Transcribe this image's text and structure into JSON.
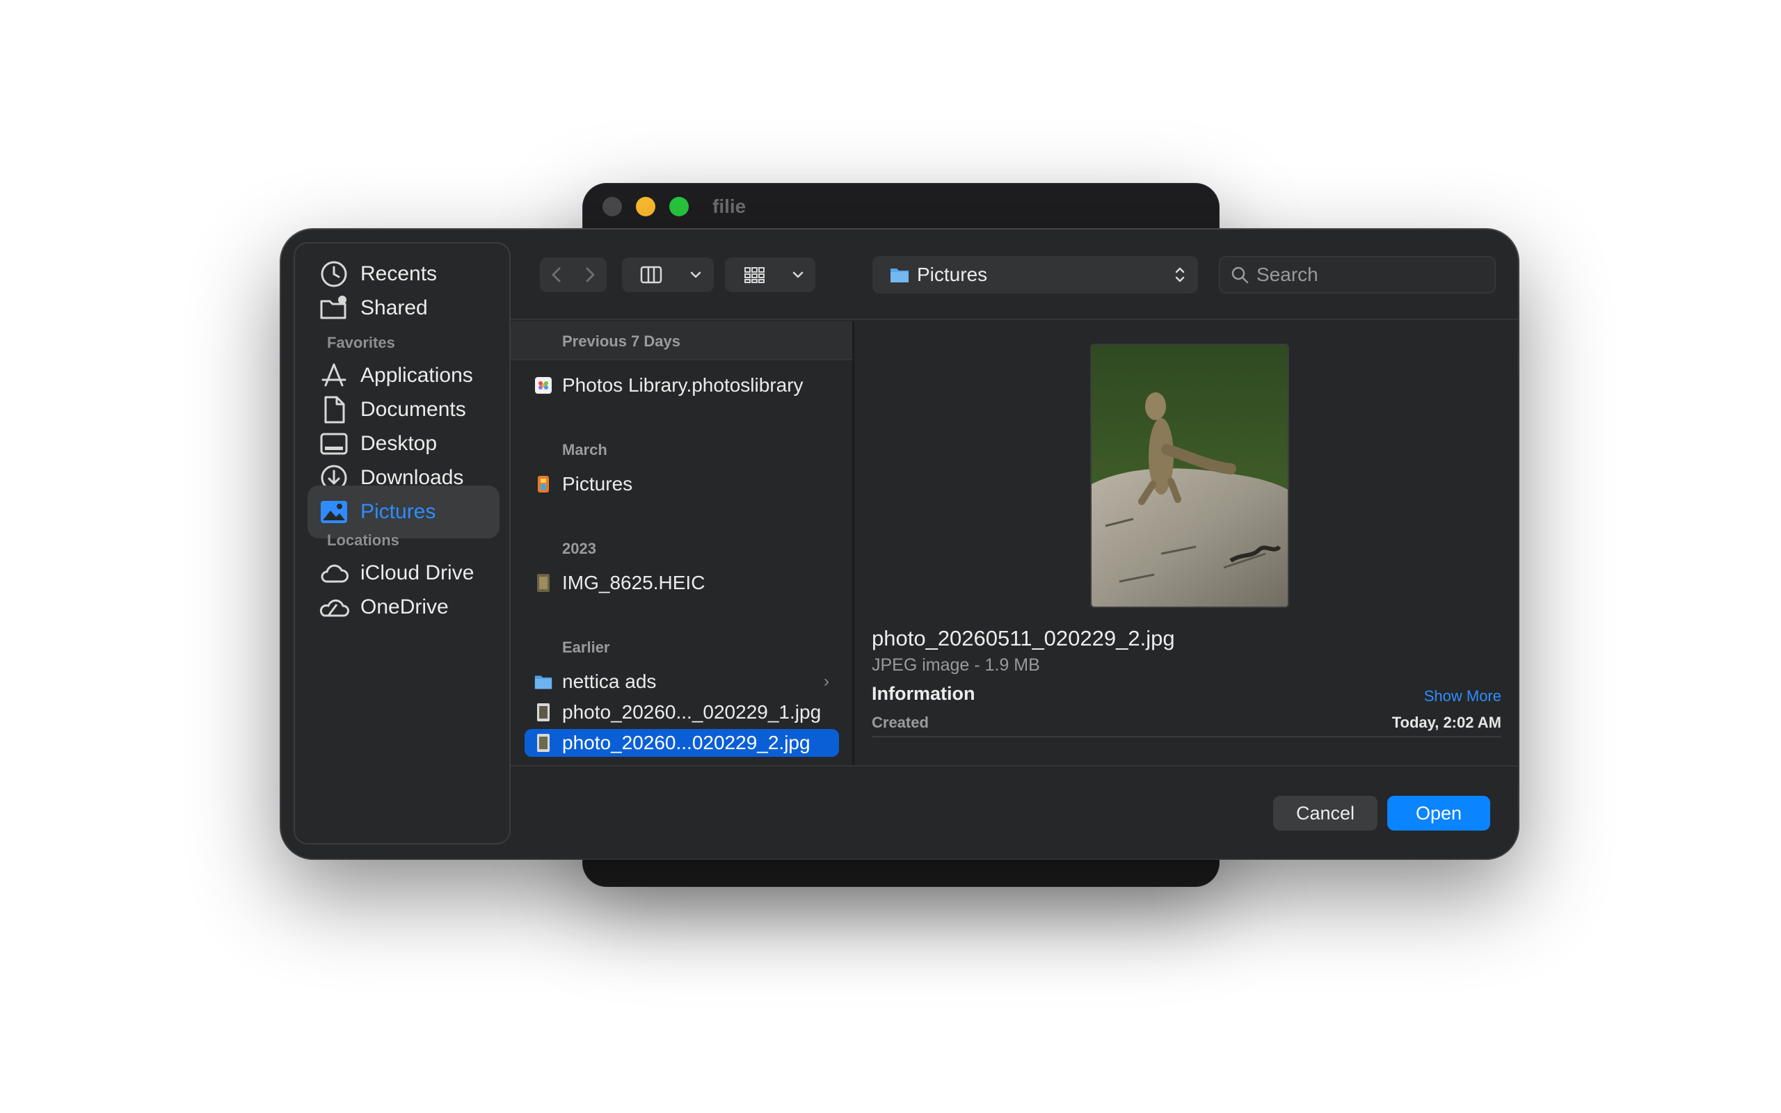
{
  "background_window": {
    "title": "filie"
  },
  "sidebar": {
    "top_items": [
      {
        "label": "Recents",
        "icon": "clock-icon"
      },
      {
        "label": "Shared",
        "icon": "shared-folder-icon"
      }
    ],
    "favorites_header": "Favorites",
    "favorites": [
      {
        "label": "Applications",
        "icon": "applications-icon"
      },
      {
        "label": "Documents",
        "icon": "document-icon"
      },
      {
        "label": "Desktop",
        "icon": "desktop-icon"
      },
      {
        "label": "Downloads",
        "icon": "download-icon"
      },
      {
        "label": "Pictures",
        "icon": "pictures-icon",
        "selected": true
      }
    ],
    "locations_header": "Locations",
    "locations": [
      {
        "label": "iCloud Drive",
        "icon": "cloud-icon"
      },
      {
        "label": "OneDrive",
        "icon": "onedrive-icon"
      }
    ]
  },
  "toolbar": {
    "location": "Pictures",
    "search_placeholder": "Search"
  },
  "file_list": {
    "sections": [
      {
        "header": "Previous 7 Days",
        "items": [
          "Photos Library.photoslibrary"
        ]
      },
      {
        "header": "March",
        "items": [
          "Pictures"
        ]
      },
      {
        "header": "2023",
        "items": [
          "IMG_8625.HEIC"
        ]
      },
      {
        "header": "Earlier",
        "items": [
          "nettica ads",
          "photo_20260..._020229_1.jpg",
          "photo_20260...020229_2.jpg"
        ]
      }
    ],
    "selected": "photo_20260...020229_2.jpg"
  },
  "preview": {
    "filename": "photo_20260511_020229_2.jpg",
    "kind": "JPEG image - 1.9 MB",
    "info_header": "Information",
    "show_more": "Show More",
    "created_label": "Created",
    "created_value": "Today, 2:02 AM"
  },
  "footer": {
    "cancel": "Cancel",
    "open": "Open"
  },
  "colors": {
    "accent": "#0a84ff",
    "selection": "#0a5fd6",
    "dialog_bg": "#252728"
  }
}
